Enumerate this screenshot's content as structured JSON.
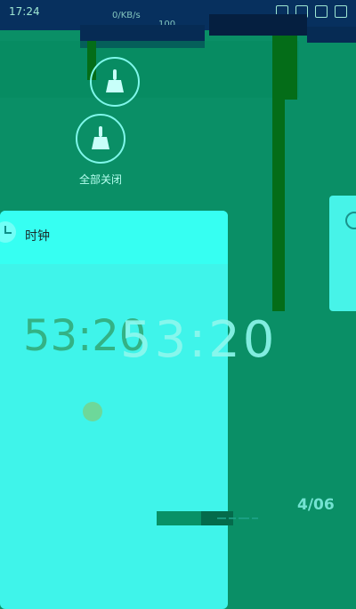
{
  "status_bar": {
    "time": "17:24",
    "speed_label": "0/KB/s",
    "battery_label": "100"
  },
  "actions": {
    "close_all_label": "全部关闭"
  },
  "clock_card": {
    "title": "时钟",
    "time_main": "53:20",
    "time_ghost": "53:20",
    "corner_text": "4/06"
  },
  "colors": {
    "background": "#0a8f66",
    "card": "#3ff4ea",
    "header": "#36fff2",
    "accent": "#7ff7ea"
  }
}
